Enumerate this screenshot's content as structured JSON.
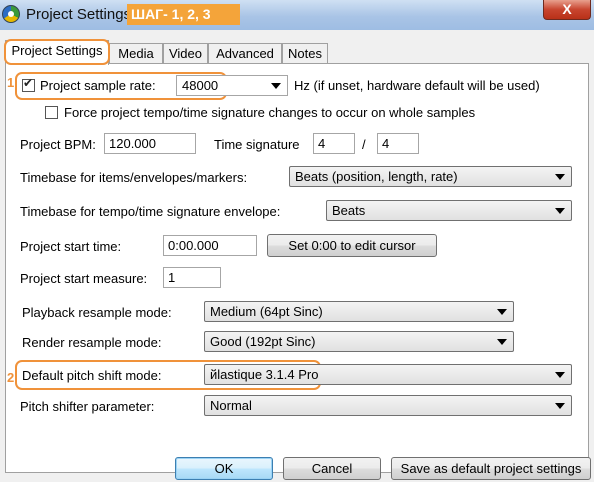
{
  "window": {
    "title": "Project Settings",
    "step_tag": "ШАГ- 1, 2, 3",
    "close_label": "X"
  },
  "tabs": [
    {
      "label": "Project Settings",
      "active": true
    },
    {
      "label": "Media"
    },
    {
      "label": "Video"
    },
    {
      "label": "Advanced"
    },
    {
      "label": "Notes"
    }
  ],
  "annotations": {
    "marker1": "1",
    "marker2": "2",
    "color": "#f0923a"
  },
  "settings": {
    "sample_rate": {
      "label": "Project sample rate:",
      "checked": true,
      "value": "48000",
      "hint": "Hz (if unset, hardware default will be used)"
    },
    "force_tempo": {
      "label": "Force project tempo/time signature changes to occur on whole samples",
      "checked": false
    },
    "bpm": {
      "label": "Project BPM:",
      "value": "120.000"
    },
    "time_sig": {
      "label": "Time signature",
      "numerator": "4",
      "separator": "/",
      "denominator": "4"
    },
    "timebase_items": {
      "label": "Timebase for items/envelopes/markers:",
      "value": "Beats (position, length, rate)"
    },
    "timebase_tempo": {
      "label": "Timebase for tempo/time signature envelope:",
      "value": "Beats"
    },
    "start_time": {
      "label": "Project start time:",
      "value": "0:00.000",
      "button": "Set 0:00 to edit cursor"
    },
    "start_measure": {
      "label": "Project start measure:",
      "value": "1"
    },
    "playback_resample": {
      "label": "Playback resample mode:",
      "value": "Medium (64pt Sinc)"
    },
    "render_resample": {
      "label": "Render resample mode:",
      "value": "Good (192pt Sinc)"
    },
    "pitch_shift": {
      "label": "Default pitch shift mode:",
      "value": "йlastique 3.1.4 Pro"
    },
    "pitch_param": {
      "label": "Pitch shifter parameter:",
      "value": "Normal"
    }
  },
  "buttons": {
    "ok": "OK",
    "cancel": "Cancel",
    "save_default": "Save as default project settings"
  }
}
